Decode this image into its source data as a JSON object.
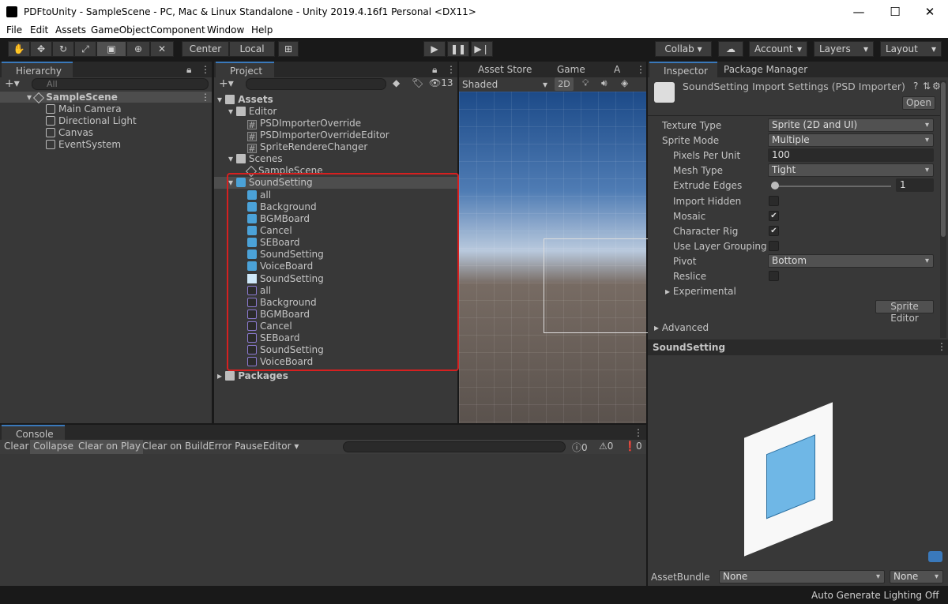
{
  "window": {
    "title": "PDFtoUnity - SampleScene - PC, Mac & Linux Standalone - Unity 2019.4.16f1 Personal <DX11>",
    "min": "—",
    "max": "☐",
    "close": "✕"
  },
  "menu": [
    "File",
    "Edit",
    "Assets",
    "GameObject",
    "Component",
    "Window",
    "Help"
  ],
  "toolbar": {
    "center": "Center",
    "local": "Local",
    "collab": "Collab ▾",
    "account": "Account",
    "layers": "Layers",
    "layout": "Layout"
  },
  "hierarchy": {
    "tab": "Hierarchy",
    "search_placeholder": "All",
    "scene": "SampleScene",
    "items": [
      "Main Camera",
      "Directional Light",
      "Canvas",
      "EventSystem"
    ]
  },
  "project": {
    "tab": "Project",
    "count": "13",
    "assets": "Assets",
    "editor": "Editor",
    "editor_items": [
      "PSDImporterOverride",
      "PSDImporterOverrideEditor",
      "SpriteRendereChanger"
    ],
    "scenes": "Scenes",
    "scene_items": [
      "SampleScene"
    ],
    "psd": "SoundSetting",
    "psd_items": [
      "all",
      "Background",
      "BGMBoard",
      "Cancel",
      "SEBoard",
      "SoundSetting",
      "VoiceBoard"
    ],
    "image_item": "SoundSetting",
    "sprite_items": [
      "all",
      "Background",
      "BGMBoard",
      "Cancel",
      "SEBoard",
      "SoundSetting",
      "VoiceBoard"
    ],
    "packages": "Packages"
  },
  "scene_view": {
    "tabs": [
      "Asset Store",
      "Game",
      "A"
    ],
    "shading": "Shaded",
    "mode2d": "2D"
  },
  "inspector": {
    "tab": "Inspector",
    "tab2": "Package Manager",
    "header": "SoundSetting Import Settings (PSD Importer)",
    "open": "Open",
    "texture_type_label": "Texture Type",
    "texture_type": "Sprite (2D and UI)",
    "sprite_mode_label": "Sprite Mode",
    "sprite_mode": "Multiple",
    "ppu_label": "Pixels Per Unit",
    "ppu": "100",
    "mesh_type_label": "Mesh Type",
    "mesh_type": "Tight",
    "extrude_label": "Extrude Edges",
    "extrude": "1",
    "import_hidden_label": "Import Hidden",
    "mosaic_label": "Mosaic",
    "character_rig_label": "Character Rig",
    "layer_grouping_label": "Use Layer Grouping",
    "pivot_label": "Pivot",
    "pivot": "Bottom",
    "reslice_label": "Reslice",
    "experimental_label": "Experimental",
    "sprite_editor": "Sprite Editor",
    "advanced_label": "Advanced",
    "preview_title": "SoundSetting",
    "assetbundle_label": "AssetBundle",
    "assetbundle": "None",
    "variant": "None"
  },
  "console": {
    "tab": "Console",
    "buttons": [
      "Clear",
      "Collapse",
      "Clear on Play",
      "Clear on Build",
      "Error Pause",
      "Editor ▾"
    ],
    "errors": "0",
    "warnings": "0",
    "infos": "0"
  },
  "status": {
    "text": "Auto Generate Lighting Off"
  },
  "colors": {
    "accent": "#3a79bb",
    "highlight": "#e02020",
    "selection": "#2c5d87"
  }
}
